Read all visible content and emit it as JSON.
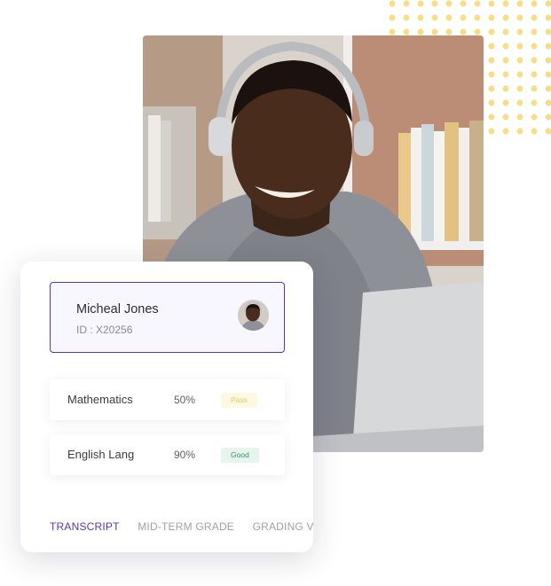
{
  "student": {
    "name": "Micheal Jones",
    "id_label": "ID : X20256"
  },
  "grades": [
    {
      "subject": "Mathematics",
      "score": "50%",
      "status": "Pass"
    },
    {
      "subject": "English Lang",
      "score": "90%",
      "status": "Good"
    }
  ],
  "tabs": [
    {
      "label": "TRANSCRIPT",
      "active": true
    },
    {
      "label": "MID-TERM GRADE",
      "active": false
    },
    {
      "label": "GRADING VIEW",
      "active": false
    }
  ],
  "colors": {
    "accent": "#5b33b8",
    "dots": "#f7dd85",
    "pass_badge": "#fff8e1",
    "good_badge": "#e6f6ee"
  }
}
